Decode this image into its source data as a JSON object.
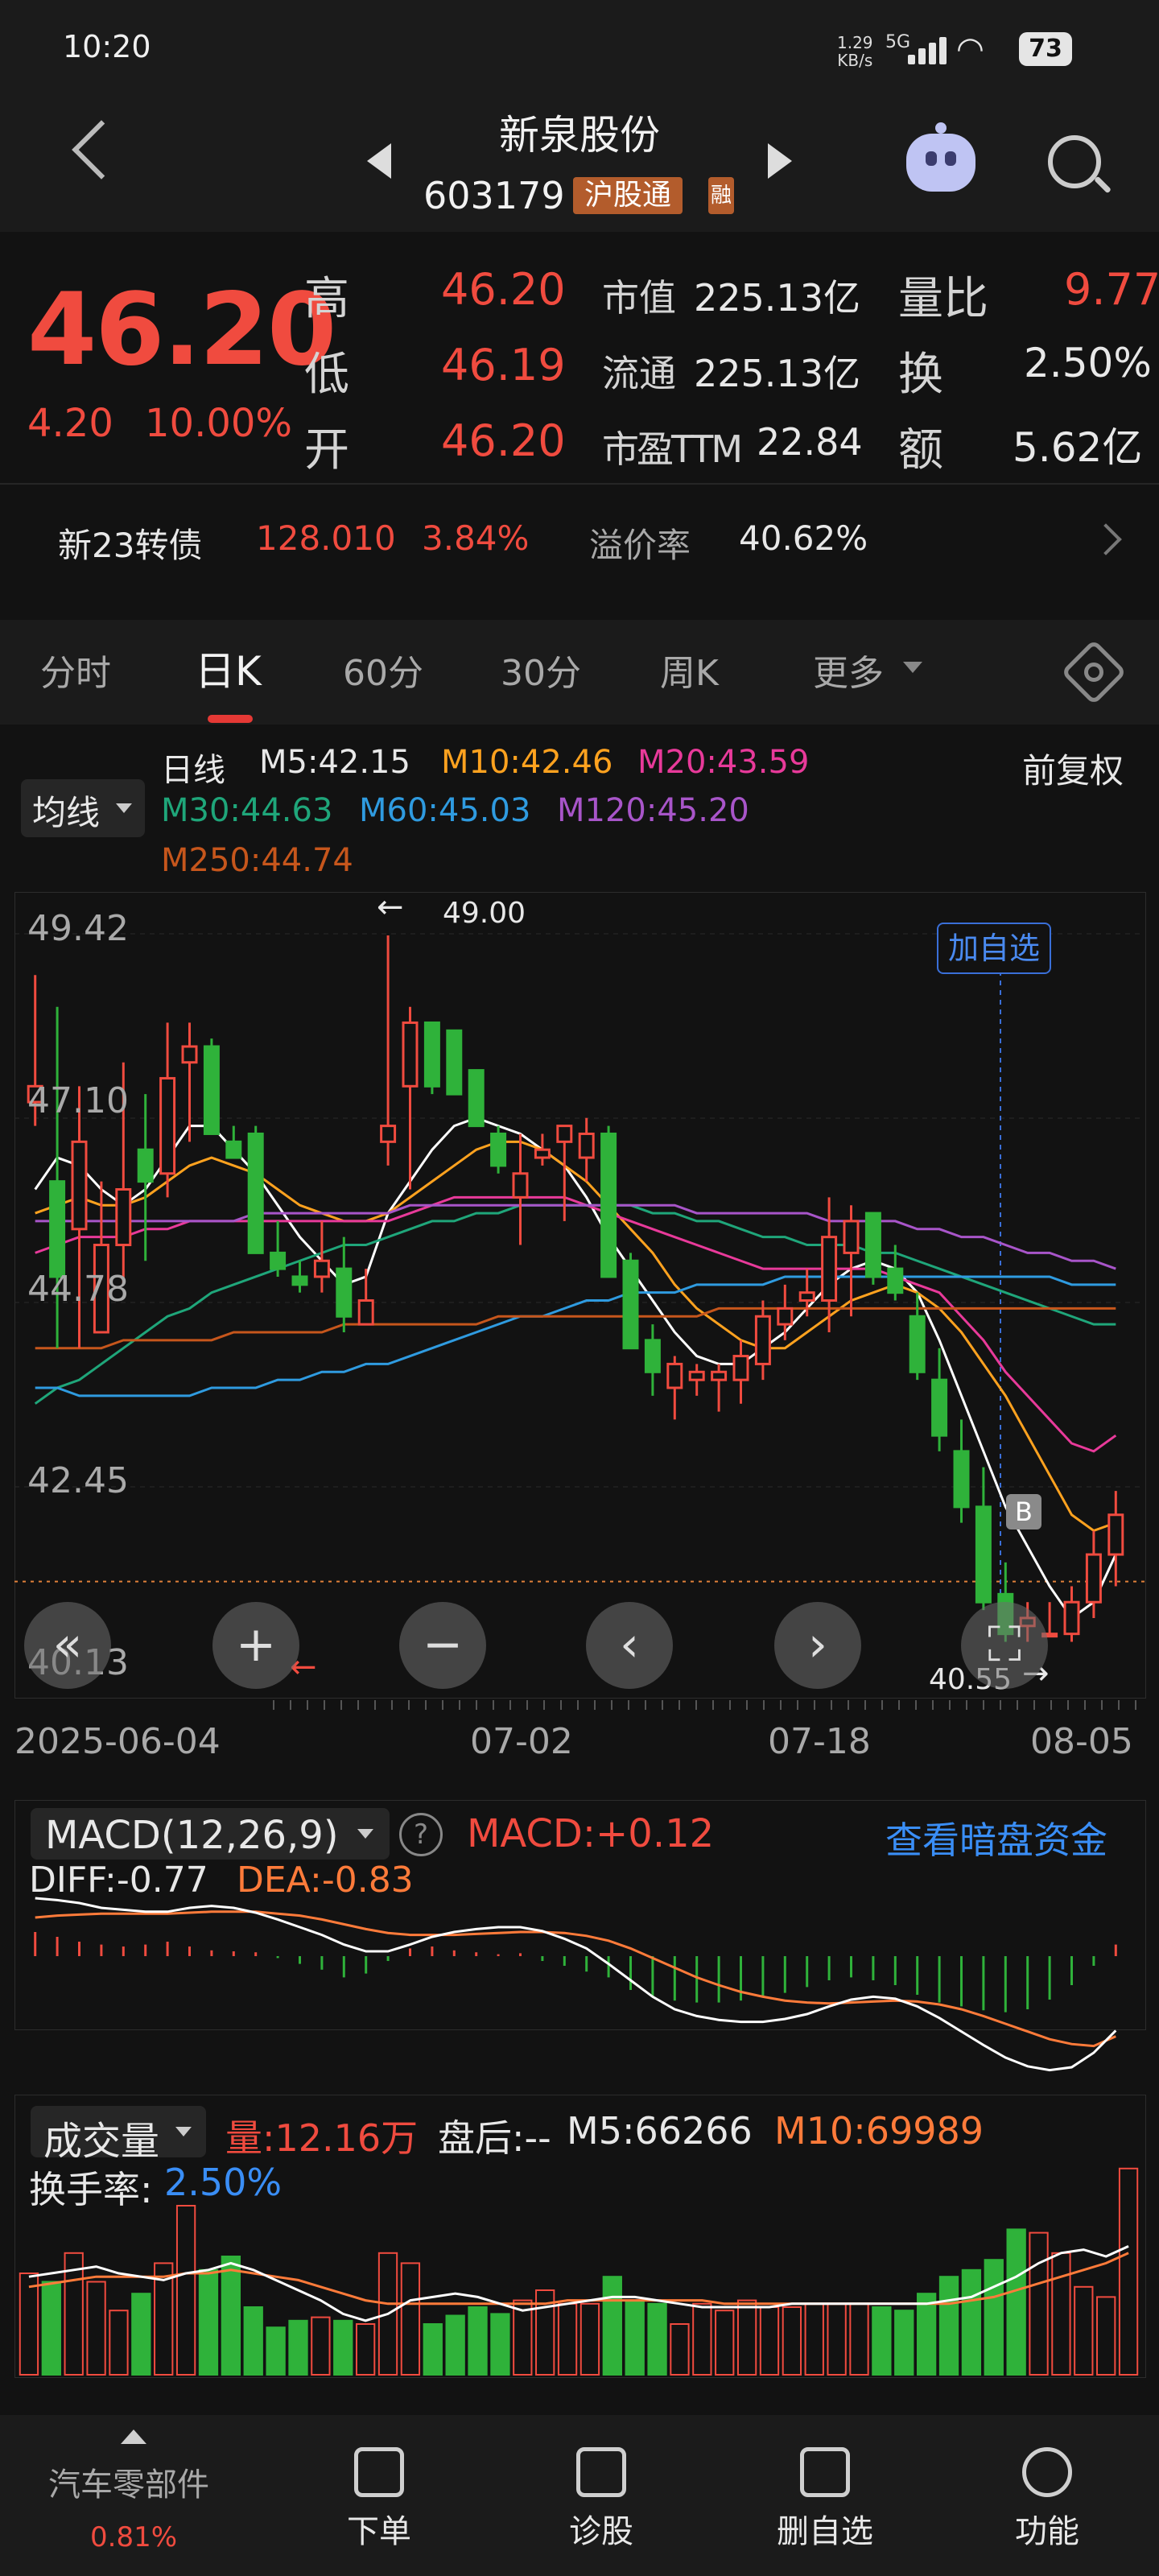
{
  "status_bar": {
    "time": "10:20",
    "net_speed": "1.29\nKB/s",
    "network": "5G",
    "battery": "73"
  },
  "header": {
    "stock_name": "新泉股份",
    "stock_code": "603179",
    "badge_hgt": "沪股通",
    "badge_rong": "融"
  },
  "quote": {
    "price": "46.20",
    "change": "4.20",
    "change_pct": "10.00%",
    "high_label": "高",
    "high": "46.20",
    "low_label": "低",
    "low": "46.19",
    "open_label": "开",
    "open": "46.20",
    "mktcap_label": "市值",
    "mktcap": "225.13亿",
    "float_label": "流通",
    "float": "225.13亿",
    "pe_label": "市盈TTM",
    "pe": "22.84",
    "volratio_label": "量比",
    "volratio": "9.77",
    "turnover_label": "换",
    "turnover": "2.50%",
    "amount_label": "额",
    "amount": "5.62亿"
  },
  "convertible": {
    "name": "新23转债",
    "price": "128.010",
    "pct": "3.84%",
    "premium_label": "溢价率",
    "premium": "40.62%"
  },
  "tabs": [
    "分时",
    "日K",
    "60分",
    "30分",
    "周K",
    "更多"
  ],
  "active_tab": "日K",
  "ma_legend": {
    "selector": "均线",
    "period": "日线",
    "ma5": "M5:42.15",
    "ma10": "M10:42.46",
    "ma20": "M20:43.59",
    "ma30": "M30:44.63",
    "ma60": "M60:45.03",
    "ma120": "M120:45.20",
    "ma250": "M250:44.74",
    "adjust": "前复权",
    "colors": {
      "ma5": "#ffffff",
      "ma10": "#ffa21f",
      "ma20": "#e83a9a",
      "ma30": "#1fa67a",
      "ma60": "#2f9be0",
      "ma120": "#a855c9",
      "ma250": "#c6561c"
    }
  },
  "chart_data": {
    "type": "candlestick",
    "y_ticks": [
      "49.42",
      "47.10",
      "44.78",
      "42.45",
      "40.13"
    ],
    "ylim": [
      40.13,
      49.42
    ],
    "x_labels": [
      "2025-06-04",
      "07-02",
      "07-18",
      "08-05"
    ],
    "max_marker": "49.00",
    "min_marker": "40.55",
    "add_watch_label": "加自选",
    "b_marker": "B",
    "current_price_line": 40.55,
    "candles": [
      [
        47.3,
        48.9,
        47.0,
        47.5
      ],
      [
        46.3,
        48.5,
        44.2,
        45.1
      ],
      [
        45.7,
        47.5,
        44.2,
        46.8
      ],
      [
        44.4,
        46.3,
        44.4,
        45.5
      ],
      [
        45.5,
        47.8,
        45.0,
        46.2
      ],
      [
        46.7,
        47.4,
        45.3,
        46.3
      ],
      [
        46.4,
        48.3,
        46.1,
        47.6
      ],
      [
        47.8,
        48.3,
        46.8,
        48.0
      ],
      [
        48.0,
        48.1,
        47.0,
        46.9
      ],
      [
        46.8,
        47.0,
        46.6,
        46.6
      ],
      [
        46.9,
        47.0,
        45.8,
        45.4
      ],
      [
        45.4,
        45.8,
        45.1,
        45.2
      ],
      [
        45.1,
        45.3,
        44.9,
        45.0
      ],
      [
        45.1,
        45.8,
        44.9,
        45.3
      ],
      [
        45.2,
        45.6,
        44.4,
        44.6
      ],
      [
        44.5,
        45.2,
        44.6,
        44.8
      ],
      [
        46.8,
        49.4,
        46.5,
        47.0
      ],
      [
        47.5,
        48.5,
        46.2,
        48.3
      ],
      [
        48.3,
        48.0,
        47.4,
        47.5
      ],
      [
        48.2,
        48.0,
        47.5,
        47.4
      ],
      [
        47.7,
        47.5,
        47.0,
        47.0
      ],
      [
        46.9,
        47.0,
        46.4,
        46.5
      ],
      [
        46.1,
        46.9,
        45.5,
        46.4
      ],
      [
        46.6,
        46.9,
        46.5,
        46.7
      ],
      [
        46.8,
        47.0,
        45.8,
        47.0
      ],
      [
        46.6,
        47.1,
        46.3,
        46.9
      ],
      [
        46.9,
        47.0,
        45.8,
        45.1
      ],
      [
        45.3,
        45.4,
        44.4,
        44.2
      ],
      [
        44.3,
        44.5,
        43.6,
        43.9
      ],
      [
        43.7,
        44.1,
        43.3,
        44.0
      ],
      [
        43.8,
        44.0,
        43.6,
        43.9
      ],
      [
        43.8,
        44.0,
        43.4,
        43.9
      ],
      [
        43.8,
        44.3,
        43.5,
        44.1
      ],
      [
        44.0,
        44.8,
        43.8,
        44.6
      ],
      [
        44.5,
        45.0,
        44.3,
        44.7
      ],
      [
        44.8,
        45.2,
        44.6,
        44.9
      ],
      [
        44.8,
        46.1,
        44.4,
        45.6
      ],
      [
        45.4,
        46.0,
        44.6,
        45.8
      ],
      [
        45.9,
        45.8,
        45.0,
        45.1
      ],
      [
        45.2,
        45.5,
        44.8,
        44.9
      ],
      [
        44.6,
        44.9,
        43.8,
        43.9
      ],
      [
        43.8,
        44.2,
        42.9,
        43.1
      ],
      [
        42.9,
        43.3,
        42.0,
        42.2
      ],
      [
        42.2,
        42.7,
        40.9,
        41.0
      ],
      [
        41.1,
        41.5,
        40.5,
        40.6
      ],
      [
        40.7,
        41.0,
        40.5,
        40.8
      ],
      [
        40.6,
        41.0,
        40.6,
        40.6
      ],
      [
        40.6,
        41.2,
        40.5,
        41.0
      ],
      [
        41.0,
        41.9,
        40.8,
        41.6
      ],
      [
        41.6,
        42.4,
        41.2,
        42.1
      ]
    ],
    "series": [
      {
        "name": "M5",
        "color": "#ffffff",
        "values": [
          46.2,
          46.6,
          46.5,
          46.2,
          46.0,
          46.2,
          46.6,
          47.0,
          47.0,
          46.7,
          46.4,
          46.0,
          45.6,
          45.3,
          45.0,
          45.1,
          45.9,
          46.3,
          46.7,
          47.0,
          47.1,
          47.0,
          46.9,
          46.7,
          46.5,
          46.1,
          45.6,
          45.2,
          44.8,
          44.4,
          44.1,
          44.0,
          44.0,
          44.2,
          44.4,
          44.7,
          45.0,
          45.2,
          45.3,
          45.2,
          44.9,
          44.3,
          43.6,
          42.9,
          42.2,
          41.7,
          41.2,
          40.8,
          41.0,
          41.6
        ]
      },
      {
        "name": "M10",
        "color": "#ffa21f",
        "values": [
          45.9,
          46.0,
          46.1,
          46.0,
          46.0,
          46.1,
          46.3,
          46.5,
          46.6,
          46.5,
          46.4,
          46.2,
          46.0,
          45.9,
          45.8,
          45.8,
          45.9,
          46.1,
          46.3,
          46.5,
          46.7,
          46.8,
          46.8,
          46.7,
          46.5,
          46.3,
          46.0,
          45.7,
          45.4,
          45.0,
          44.7,
          44.5,
          44.3,
          44.2,
          44.2,
          44.4,
          44.6,
          44.8,
          44.9,
          45.0,
          44.9,
          44.7,
          44.4,
          44.0,
          43.6,
          43.1,
          42.6,
          42.1,
          41.9,
          42.0
        ]
      },
      {
        "name": "M20",
        "color": "#e83a9a",
        "values": [
          45.4,
          45.5,
          45.6,
          45.6,
          45.6,
          45.7,
          45.7,
          45.8,
          45.8,
          45.8,
          45.8,
          45.8,
          45.8,
          45.8,
          45.8,
          45.8,
          45.8,
          45.9,
          46.0,
          46.1,
          46.1,
          46.1,
          46.1,
          46.1,
          46.1,
          46.0,
          45.9,
          45.8,
          45.7,
          45.6,
          45.5,
          45.4,
          45.3,
          45.2,
          45.2,
          45.2,
          45.2,
          45.2,
          45.2,
          45.1,
          45.0,
          44.9,
          44.6,
          44.3,
          43.9,
          43.6,
          43.3,
          43.0,
          42.9,
          43.1
        ]
      },
      {
        "name": "M30",
        "color": "#1fa67a",
        "values": [
          43.5,
          43.7,
          43.8,
          44.0,
          44.2,
          44.4,
          44.6,
          44.7,
          44.9,
          45.0,
          45.1,
          45.2,
          45.3,
          45.4,
          45.5,
          45.5,
          45.6,
          45.7,
          45.8,
          45.8,
          45.9,
          45.9,
          46.0,
          46.0,
          46.0,
          46.0,
          46.0,
          46.0,
          45.9,
          45.9,
          45.8,
          45.8,
          45.7,
          45.6,
          45.6,
          45.5,
          45.5,
          45.5,
          45.4,
          45.4,
          45.3,
          45.2,
          45.1,
          45.0,
          44.9,
          44.8,
          44.7,
          44.6,
          44.5,
          44.5
        ]
      },
      {
        "name": "M60",
        "color": "#2f9be0",
        "values": [
          43.7,
          43.7,
          43.6,
          43.6,
          43.6,
          43.6,
          43.6,
          43.6,
          43.7,
          43.7,
          43.7,
          43.8,
          43.8,
          43.9,
          43.9,
          44.0,
          44.0,
          44.1,
          44.2,
          44.3,
          44.4,
          44.5,
          44.6,
          44.6,
          44.7,
          44.8,
          44.8,
          44.9,
          44.9,
          44.9,
          45.0,
          45.0,
          45.0,
          45.0,
          45.1,
          45.1,
          45.1,
          45.1,
          45.1,
          45.1,
          45.1,
          45.1,
          45.1,
          45.1,
          45.1,
          45.1,
          45.1,
          45.0,
          45.0,
          45.0
        ]
      },
      {
        "name": "M120",
        "color": "#a855c9",
        "values": [
          45.8,
          45.8,
          45.8,
          45.8,
          45.8,
          45.8,
          45.8,
          45.8,
          45.8,
          45.8,
          45.9,
          45.9,
          45.9,
          45.9,
          45.9,
          45.9,
          45.9,
          46.0,
          46.0,
          46.0,
          46.0,
          46.0,
          46.0,
          46.0,
          46.0,
          46.0,
          46.0,
          46.0,
          46.0,
          46.0,
          45.9,
          45.9,
          45.9,
          45.9,
          45.9,
          45.9,
          45.8,
          45.8,
          45.8,
          45.8,
          45.7,
          45.7,
          45.6,
          45.6,
          45.5,
          45.4,
          45.4,
          45.3,
          45.3,
          45.2
        ]
      },
      {
        "name": "M250",
        "color": "#c6561c",
        "values": [
          44.2,
          44.2,
          44.2,
          44.2,
          44.3,
          44.3,
          44.3,
          44.3,
          44.3,
          44.4,
          44.4,
          44.4,
          44.4,
          44.4,
          44.5,
          44.5,
          44.5,
          44.5,
          44.5,
          44.5,
          44.5,
          44.6,
          44.6,
          44.6,
          44.6,
          44.6,
          44.6,
          44.6,
          44.6,
          44.6,
          44.6,
          44.7,
          44.7,
          44.7,
          44.7,
          44.7,
          44.7,
          44.7,
          44.7,
          44.7,
          44.7,
          44.7,
          44.7,
          44.7,
          44.7,
          44.7,
          44.7,
          44.7,
          44.7,
          44.7
        ]
      }
    ]
  },
  "macd": {
    "selector": "MACD(12,26,9)",
    "value": "MACD:+0.12",
    "link": "查看暗盘资金",
    "diff": "DIFF:-0.77",
    "dea": "DEA:-0.83",
    "hist": [
      0.25,
      0.2,
      0.15,
      0.12,
      0.1,
      0.12,
      0.15,
      0.1,
      0.06,
      0.05,
      0.04,
      -0.02,
      -0.08,
      -0.14,
      -0.22,
      -0.18,
      -0.05,
      0.08,
      0.1,
      0.06,
      0.04,
      0.02,
      0.03,
      -0.05,
      -0.1,
      -0.16,
      -0.22,
      -0.35,
      -0.42,
      -0.46,
      -0.48,
      -0.48,
      -0.46,
      -0.42,
      -0.38,
      -0.32,
      -0.25,
      -0.22,
      -0.25,
      -0.3,
      -0.4,
      -0.48,
      -0.52,
      -0.56,
      -0.58,
      -0.55,
      -0.45,
      -0.3,
      -0.1,
      0.12
    ],
    "diff_values": [
      0.6,
      0.58,
      0.55,
      0.5,
      0.48,
      0.46,
      0.46,
      0.5,
      0.52,
      0.5,
      0.45,
      0.38,
      0.3,
      0.22,
      0.12,
      0.05,
      0.05,
      0.12,
      0.2,
      0.25,
      0.28,
      0.3,
      0.3,
      0.26,
      0.18,
      0.08,
      -0.08,
      -0.25,
      -0.42,
      -0.55,
      -0.62,
      -0.66,
      -0.68,
      -0.68,
      -0.65,
      -0.6,
      -0.52,
      -0.45,
      -0.42,
      -0.44,
      -0.52,
      -0.64,
      -0.78,
      -0.92,
      -1.05,
      -1.14,
      -1.18,
      -1.15,
      -1.0,
      -0.77
    ],
    "dea_values": [
      0.4,
      0.42,
      0.43,
      0.44,
      0.44,
      0.44,
      0.44,
      0.45,
      0.46,
      0.46,
      0.46,
      0.44,
      0.42,
      0.38,
      0.33,
      0.28,
      0.24,
      0.22,
      0.22,
      0.22,
      0.23,
      0.24,
      0.25,
      0.25,
      0.24,
      0.21,
      0.16,
      0.08,
      -0.02,
      -0.12,
      -0.22,
      -0.3,
      -0.37,
      -0.42,
      -0.46,
      -0.48,
      -0.49,
      -0.48,
      -0.47,
      -0.46,
      -0.47,
      -0.5,
      -0.55,
      -0.62,
      -0.7,
      -0.78,
      -0.86,
      -0.91,
      -0.93,
      -0.83
    ]
  },
  "volume": {
    "selector": "成交量",
    "amount": "量:12.16万",
    "after_hours": "盘后:--",
    "m5": "M5:66266",
    "m10": "M10:69989",
    "turnover_label": "换手率:",
    "turnover": "2.50%",
    "bars": [
      60,
      55,
      72,
      55,
      38,
      48,
      66,
      100,
      62,
      70,
      40,
      28,
      32,
      34,
      32,
      30,
      72,
      66,
      30,
      35,
      40,
      36,
      44,
      50,
      42,
      42,
      58,
      44,
      42,
      30,
      42,
      38,
      44,
      40,
      40,
      42,
      42,
      42,
      40,
      38,
      48,
      58,
      62,
      68,
      86,
      84,
      72,
      52,
      46,
      122
    ],
    "m5_values": [
      58,
      60,
      62,
      64,
      60,
      58,
      56,
      60,
      62,
      66,
      62,
      56,
      50,
      44,
      36,
      32,
      36,
      44,
      46,
      48,
      46,
      42,
      38,
      40,
      42,
      44,
      46,
      46,
      44,
      42,
      40,
      40,
      40,
      40,
      42,
      42,
      42,
      42,
      42,
      42,
      42,
      44,
      46,
      52,
      58,
      66,
      72,
      74,
      70,
      76
    ],
    "m10_values": [
      52,
      54,
      56,
      58,
      58,
      58,
      58,
      60,
      60,
      62,
      60,
      58,
      56,
      52,
      48,
      44,
      42,
      42,
      42,
      42,
      42,
      42,
      42,
      42,
      44,
      44,
      44,
      44,
      44,
      44,
      44,
      42,
      42,
      42,
      42,
      42,
      42,
      42,
      42,
      42,
      42,
      42,
      44,
      46,
      50,
      54,
      58,
      62,
      66,
      72
    ]
  },
  "bottom_bar": {
    "sector": "汽车零部件",
    "sector_pct": "0.81%",
    "items": [
      "下单",
      "诊股",
      "删自选",
      "功能"
    ]
  }
}
